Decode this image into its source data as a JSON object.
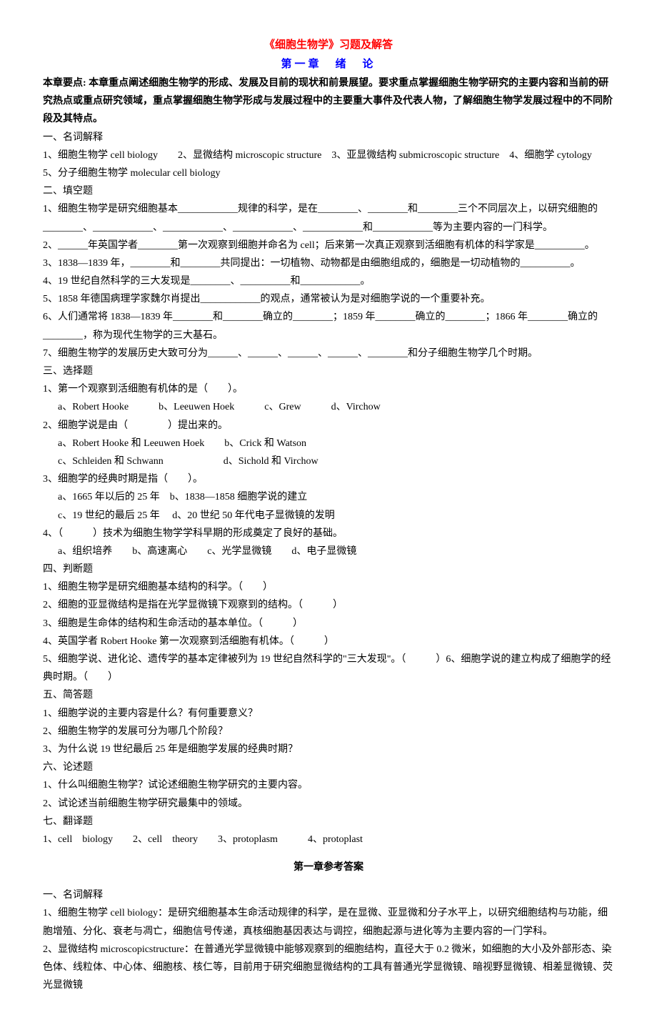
{
  "title_main": "《细胞生物学》习题及解答",
  "title_chapter": "第一章　绪　论",
  "keypoints_label": "本章要点:",
  "keypoints_text": "本章重点阐述细胞生物学的形成、发展及目前的现状和前景展望。要求重点掌握细胞生物学研究的主要内容和当前的研究热点或重点研究领域，重点掌握细胞生物学形成与发展过程中的主要重大事件及代表人物，了解细胞生物学发展过程中的不同阶段及其特点。",
  "section1": {
    "heading": "一、名词解释",
    "items": [
      "1、细胞生物学 cell biology　　2、显微结构 microscopic structure　3、亚显微结构 submicroscopic structure　4、细胞学 cytology",
      "5、分子细胞生物学 molecular cell biology"
    ]
  },
  "section2": {
    "heading": "二、填空题",
    "items": [
      "1、细胞生物学是研究细胞基本____________规律的科学，是在________、________和________三个不同层次上，以研究细胞的________、____________、____________、____________、____________和____________等为主要内容的一门科学。",
      "2、______年英国学者________第一次观察到细胞并命名为 cell；后来第一次真正观察到活细胞有机体的科学家是__________。",
      "3、1838—1839 年，________和________共同提出：一切植物、动物都是由细胞组成的，细胞是一切动植物的__________。",
      "4、19 世纪自然科学的三大发现是________、__________和____________。",
      "5、1858 年德国病理学家魏尔肖提出____________的观点，通常被认为是对细胞学说的一个重要补充。",
      "6、人们通常将 1838—1839 年________和________确立的________；1859 年________确立的________；1866 年________确立的________，称为现代生物学的三大基石。",
      "7、细胞生物学的发展历史大致可分为______、______、______、______、________和分子细胞生物学几个时期。"
    ]
  },
  "section3": {
    "heading": "三、选择题",
    "q1": {
      "stem": "1、第一个观察到活细胞有机体的是（　　）。",
      "opts": "a、Robert Hooke　　　b、Leeuwen Hoek　　　c、Grew　　　d、Virchow"
    },
    "q2": {
      "stem": "2、细胞学说是由（　　　　）提出来的。",
      "opt1": "a、Robert Hooke 和 Leeuwen Hoek　　b、Crick 和 Watson",
      "opt2": "c、Schleiden 和 Schwann　　　　　　d、Sichold 和 Virchow"
    },
    "q3": {
      "stem": "3、细胞学的经典时期是指（　　）。",
      "opt1": "a、1665 年以后的 25 年　b、1838—1858 细胞学说的建立",
      "opt2": "c、19 世纪的最后 25 年　 d、20 世纪 50 年代电子显微镜的发明"
    },
    "q4": {
      "stem": "4、（　　　）技术为细胞生物学学科早期的形成奠定了良好的基础。",
      "opts": "a、组织培养　　b、高速离心　　c、光学显微镜　　d、电子显微镜"
    }
  },
  "section4": {
    "heading": "四、判断题",
    "items": [
      "1、细胞生物学是研究细胞基本结构的科学。（　　）",
      "2、细胞的亚显微结构是指在光学显微镜下观察到的结构。（　　　）",
      "3、细胞是生命体的结构和生命活动的基本单位。（　　　）",
      "4、英国学者 Robert Hooke 第一次观察到活细胞有机体。（　　　）",
      "5、细胞学说、进化论、遗传学的基本定律被列为 19 世纪自然科学的\"三大发现\"。（　　　）6、细胞学说的建立构成了细胞学的经典时期。（　　）"
    ]
  },
  "section5": {
    "heading": "五、简答题",
    "items": [
      "1、细胞学说的主要内容是什么？有何重要意义？",
      "2、细胞生物学的发展可分为哪几个阶段？",
      "3、为什么说 19 世纪最后 25 年是细胞学发展的经典时期？"
    ]
  },
  "section6": {
    "heading": "六、论述题",
    "items": [
      "1、什么叫细胞生物学？试论述细胞生物学研究的主要内容。",
      "2、试论述当前细胞生物学研究最集中的领域。"
    ]
  },
  "section7": {
    "heading": "七、翻译题",
    "items": [
      "1、cell　biology　　2、cell　theory　　3、protoplasm　　　4、protoplast"
    ]
  },
  "answer_title": "第一章参考答案",
  "ans_section1": {
    "heading": "一、名词解释",
    "items": [
      "1、细胞生物学 cell biology：是研究细胞基本生命活动规律的科学，是在显微、亚显微和分子水平上，以研究细胞结构与功能，细胞增殖、分化、衰老与凋亡，细胞信号传递，真核细胞基因表达与调控，细胞起源与进化等为主要内容的一门学科。",
      "2、显微结构 microscopicstructure：在普通光学显微镜中能够观察到的细胞结构，直径大于 0.2 微米，如细胞的大小及外部形态、染色体、线粒体、中心体、细胞核、核仁等，目前用于研究细胞显微结构的工具有普通光学显微镜、暗视野显微镜、相差显微镜、荧光显微镜"
    ]
  }
}
